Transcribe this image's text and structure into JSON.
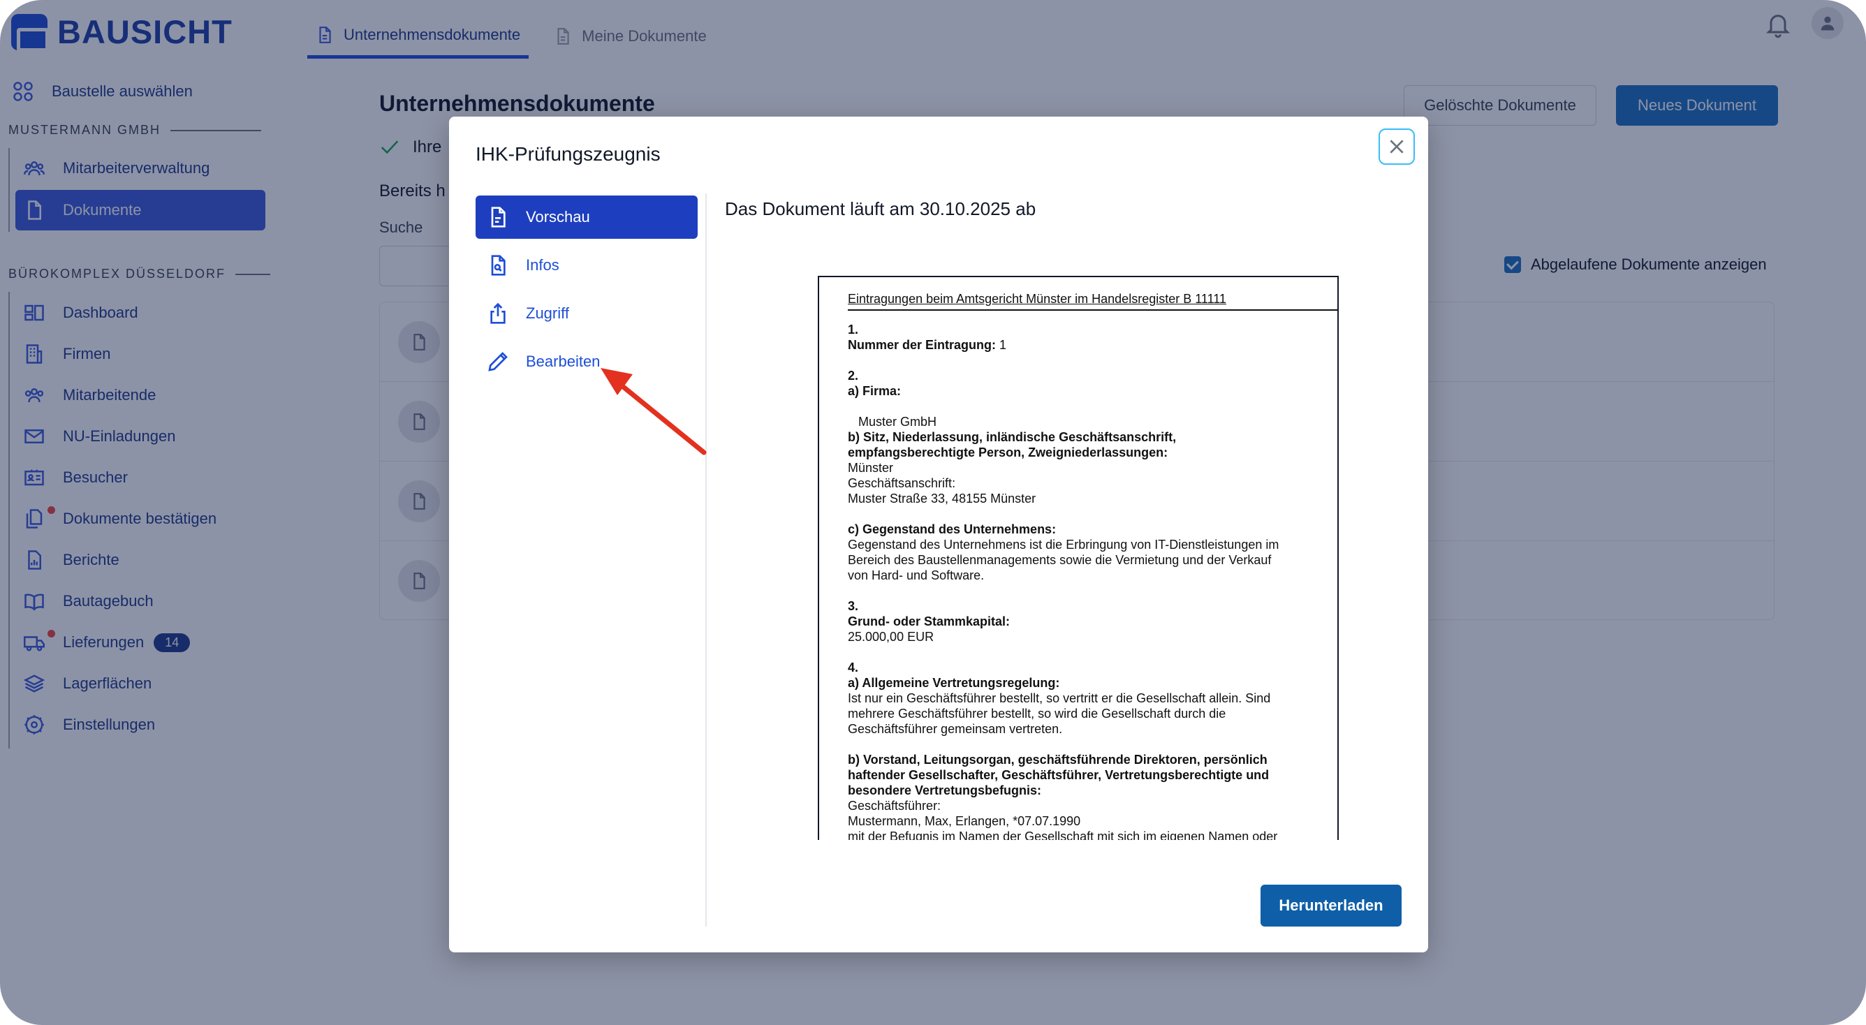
{
  "app": {
    "logo_text": "BAUSICHT"
  },
  "header": {
    "tabs": [
      {
        "label": "Unternehmensdokumente",
        "icon": "document-icon",
        "active": true
      },
      {
        "label": "Meine Dokumente",
        "icon": "document-icon",
        "active": false
      }
    ]
  },
  "sidebar": {
    "select_site": "Baustelle auswählen",
    "section1": "MUSTERMANN GMBH",
    "section1_items": [
      {
        "label": "Mitarbeiterverwaltung",
        "icon": "users-icon"
      },
      {
        "label": "Dokumente",
        "icon": "document-icon",
        "active": true
      }
    ],
    "section2": "BÜROKOMPLEX DÜSSELDORF",
    "section2_items": [
      {
        "label": "Dashboard",
        "icon": "dashboard-icon"
      },
      {
        "label": "Firmen",
        "icon": "building-icon"
      },
      {
        "label": "Mitarbeitende",
        "icon": "users-icon"
      },
      {
        "label": "NU-Einladungen",
        "icon": "mail-icon"
      },
      {
        "label": "Besucher",
        "icon": "id-card-icon"
      },
      {
        "label": "Dokumente bestätigen",
        "icon": "documents-icon",
        "dot": true
      },
      {
        "label": "Berichte",
        "icon": "report-icon"
      },
      {
        "label": "Bautagebuch",
        "icon": "book-icon"
      },
      {
        "label": "Lieferungen",
        "icon": "truck-icon",
        "dot": true,
        "badge": "14"
      },
      {
        "label": "Lagerflächen",
        "icon": "layers-icon"
      },
      {
        "label": "Einstellungen",
        "icon": "gear-icon"
      }
    ]
  },
  "main": {
    "title": "Unternehmensdokumente",
    "deleted_button": "Gelöschte Dokumente",
    "new_button": "Neues Dokument",
    "check_text": "Ihre",
    "bereits_text": "Bereits h",
    "search_label": "Suche",
    "show_expired": "Abgelaufene Dokumente anzeigen"
  },
  "modal": {
    "title": "IHK-Prüfungszeugnis",
    "nav": [
      {
        "label": "Vorschau",
        "icon": "document-icon",
        "active": true
      },
      {
        "label": "Infos",
        "icon": "file-search-icon",
        "active": false
      },
      {
        "label": "Zugriff",
        "icon": "share-icon",
        "active": false
      },
      {
        "label": "Bearbeiten",
        "icon": "pencil-icon",
        "active": false
      }
    ],
    "expiry_text": "Das Dokument läuft am 30.10.2025 ab",
    "download_button": "Herunterladen",
    "document": {
      "header": "Eintragungen beim Amtsgericht Münster im Handelsregister B  11111",
      "lines": [
        {
          "t": "1.",
          "b": true
        },
        {
          "t": "Nummer der Eintragung:",
          "b": true,
          "rest": " 1"
        },
        {
          "t": "",
          "b": false
        },
        {
          "t": "2.",
          "b": true
        },
        {
          "t": "a) Firma:",
          "b": true
        },
        {
          "t": "",
          "b": false
        },
        {
          "t": "   Muster GmbH",
          "b": false
        },
        {
          "t": "b) Sitz, Niederlassung, inländische Geschäftsanschrift,",
          "b": true
        },
        {
          "t": "empfangsberechtigte Person, Zweigniederlassungen:",
          "b": true
        },
        {
          "t": "Münster",
          "b": false
        },
        {
          "t": "Geschäftsanschrift:",
          "b": false
        },
        {
          "t": "Muster Straße 33, 48155 Münster",
          "b": false
        },
        {
          "t": "",
          "b": false
        },
        {
          "t": "c) Gegenstand des Unternehmens:",
          "b": true
        },
        {
          "t": "Gegenstand des Unternehmens ist die Erbringung von IT-Dienstleistungen im",
          "b": false
        },
        {
          "t": "Bereich des Baustellenmanagements sowie die Vermietung und der Verkauf",
          "b": false
        },
        {
          "t": "von Hard- und Software.",
          "b": false
        },
        {
          "t": "",
          "b": false
        },
        {
          "t": "3.",
          "b": true
        },
        {
          "t": "Grund- oder Stammkapital:",
          "b": true
        },
        {
          "t": "25.000,00 EUR",
          "b": false
        },
        {
          "t": "",
          "b": false
        },
        {
          "t": "4.",
          "b": true
        },
        {
          "t": "a) Allgemeine Vertretungsregelung:",
          "b": true
        },
        {
          "t": "Ist nur ein Geschäftsführer bestellt, so vertritt er die Gesellschaft allein. Sind",
          "b": false
        },
        {
          "t": "mehrere Geschäftsführer bestellt, so wird die Gesellschaft durch die",
          "b": false
        },
        {
          "t": "Geschäftsführer gemeinsam vertreten.",
          "b": false
        },
        {
          "t": "",
          "b": false
        },
        {
          "t": "b) Vorstand, Leitungsorgan, geschäftsführende Direktoren, persönlich",
          "b": true
        },
        {
          "t": "haftender Gesellschafter, Geschäftsführer, Vertretungsberechtigte und",
          "b": true
        },
        {
          "t": "besondere Vertretungsbefugnis:",
          "b": true
        },
        {
          "t": "Geschäftsführer:",
          "b": false
        },
        {
          "t": "Mustermann, Max, Erlangen, *07.07.1990",
          "b": false
        },
        {
          "t": "mit der Befugnis im Namen der Gesellschaft mit sich im eigenen Namen oder",
          "b": false
        }
      ]
    }
  },
  "colors": {
    "accent": "#1d3fbf",
    "download": "#0f5fa8",
    "arrow": "#e3301f",
    "overlay": "rgba(16,30,70,0.48)"
  }
}
